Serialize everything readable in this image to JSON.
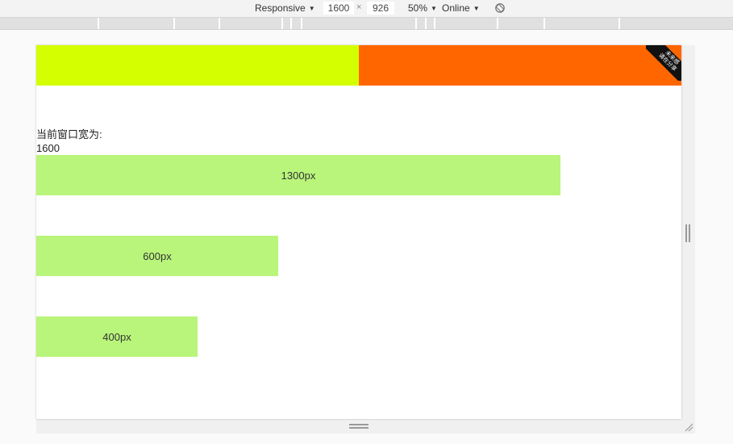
{
  "toolbar": {
    "device_mode": "Responsive",
    "width_value": "1600",
    "times_symbol": "×",
    "height_value": "926",
    "zoom": "50%",
    "throttle": "Online",
    "rotate_icon": "rotate-icon",
    "caret_icon": "caret-down-icon"
  },
  "page": {
    "ribbon_line1": "未来感",
    "ribbon_line2": "请在分享",
    "width_label": "当前窗口宽为:",
    "width_value": "1600",
    "boxes": [
      {
        "label": "1300px"
      },
      {
        "label": "600px"
      },
      {
        "label": "400px"
      }
    ]
  },
  "colors": {
    "header_left": "#d4ff00",
    "header_right": "#ff6600",
    "box_fill": "#b9f57a",
    "ribbon": "#111111"
  }
}
